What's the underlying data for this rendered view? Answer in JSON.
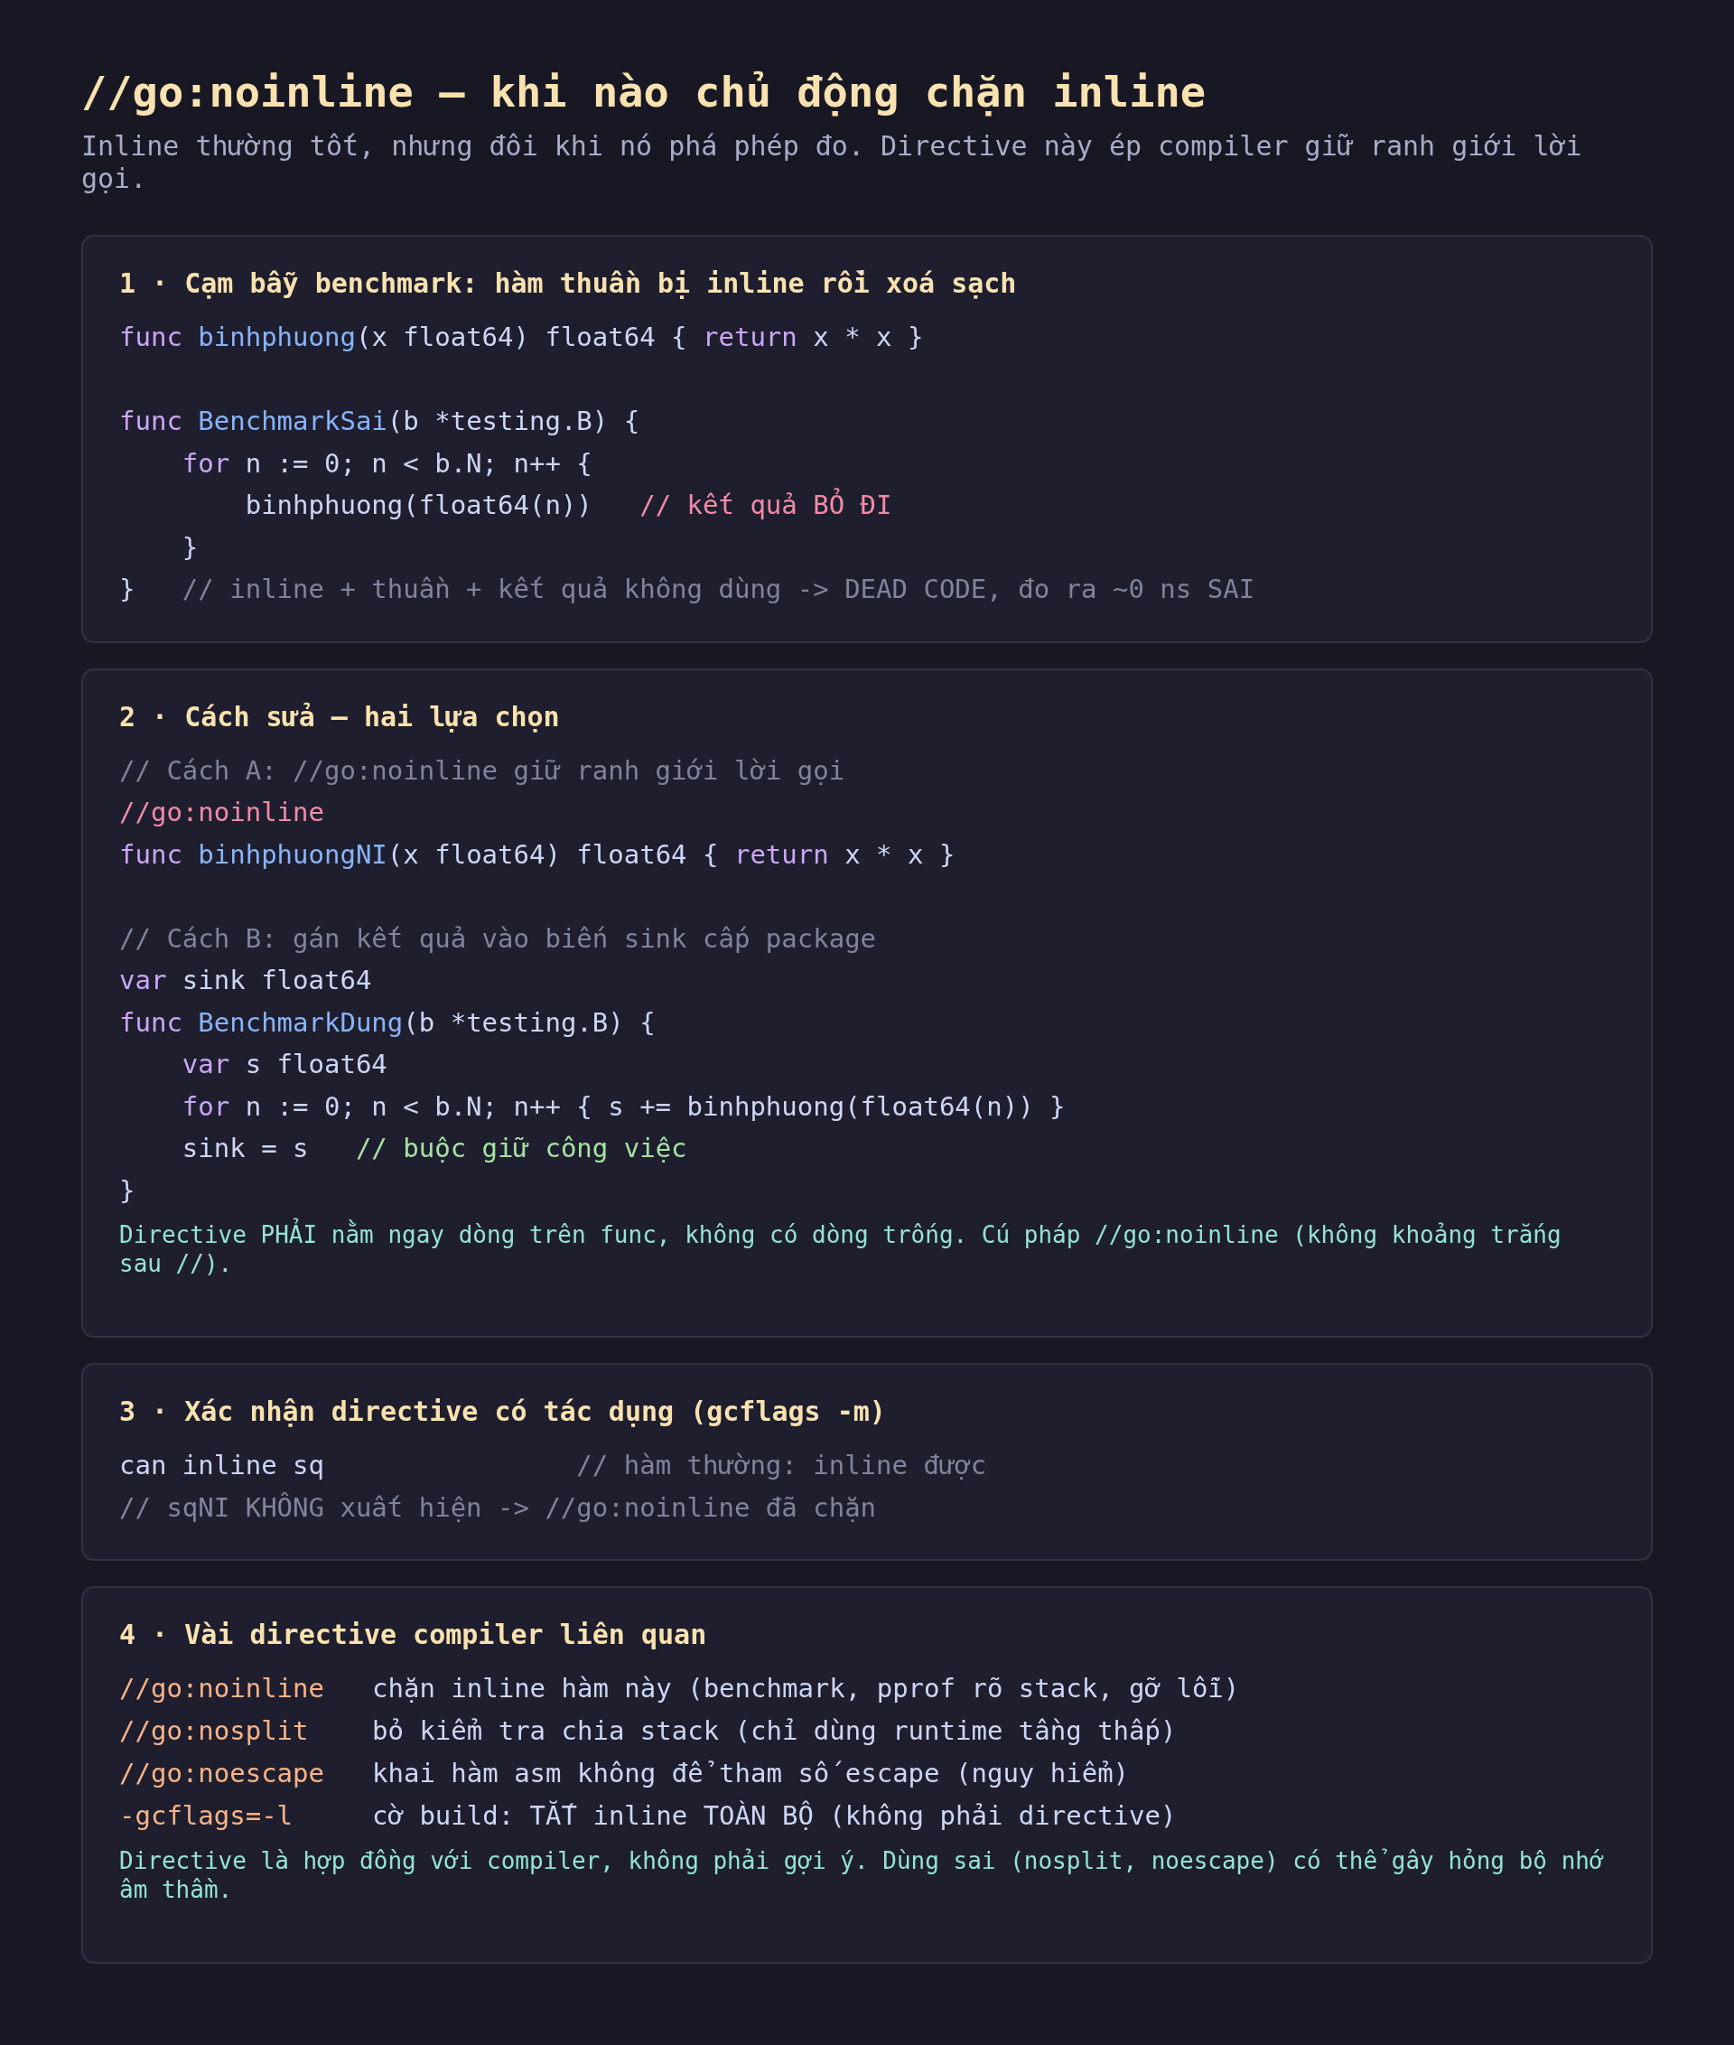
{
  "title": "//go:noinline — khi nào chủ động chặn inline",
  "subtitle": "Inline thường tốt, nhưng đôi khi nó phá phép đo. Directive này ép compiler giữ ranh giới lời gọi.",
  "cards": [
    {
      "kind": "code",
      "heading": "1 · Cạm bẫy benchmark: hàm thuần bị inline rồi xoá sạch",
      "lines": [
        {
          "kind": "code",
          "tokens": [
            {
              "kind": "kw",
              "text": "func "
            },
            {
              "kind": "fn",
              "text": "binhphuong"
            },
            {
              "kind": "plain",
              "text": "(x float64) float64 { "
            },
            {
              "kind": "kw",
              "text": "return"
            },
            {
              "kind": "plain",
              "text": " x * x }"
            }
          ]
        },
        {
          "kind": "blank"
        },
        {
          "kind": "code",
          "tokens": [
            {
              "kind": "kw",
              "text": "func "
            },
            {
              "kind": "fn",
              "text": "BenchmarkSai"
            },
            {
              "kind": "plain",
              "text": "(b *testing.B) {"
            }
          ]
        },
        {
          "kind": "code",
          "tokens": [
            {
              "kind": "kw",
              "text": "    for"
            },
            {
              "kind": "plain",
              "text": " n := 0; n < b.N; n++ {"
            }
          ]
        },
        {
          "kind": "code",
          "tokens": [
            {
              "kind": "plain",
              "text": "        binhphuong(float64(n))   "
            },
            {
              "kind": "warn",
              "text": "// kết quả BỎ ĐI"
            }
          ]
        },
        {
          "kind": "code",
          "tokens": [
            {
              "kind": "plain",
              "text": "    }"
            }
          ]
        },
        {
          "kind": "code",
          "tokens": [
            {
              "kind": "plain",
              "text": "}   "
            },
            {
              "kind": "comment",
              "text": "// inline + thuần + kết quả không dùng -> DEAD CODE, đo ra ~0 ns SAI"
            }
          ]
        }
      ]
    },
    {
      "kind": "code",
      "heading": "2 · Cách sửa — hai lựa chọn",
      "lines": [
        {
          "kind": "code",
          "tokens": [
            {
              "kind": "comment",
              "text": "// Cách A: //go:noinline giữ ranh giới lời gọi"
            }
          ]
        },
        {
          "kind": "code",
          "tokens": [
            {
              "kind": "warn",
              "text": "//go:noinline"
            }
          ]
        },
        {
          "kind": "code",
          "tokens": [
            {
              "kind": "kw",
              "text": "func "
            },
            {
              "kind": "fn",
              "text": "binhphuongNI"
            },
            {
              "kind": "plain",
              "text": "(x float64) float64 { "
            },
            {
              "kind": "kw",
              "text": "return"
            },
            {
              "kind": "plain",
              "text": " x * x }"
            }
          ]
        },
        {
          "kind": "blank"
        },
        {
          "kind": "code",
          "tokens": [
            {
              "kind": "comment",
              "text": "// Cách B: gán kết quả vào biến sink cấp package"
            }
          ]
        },
        {
          "kind": "code",
          "tokens": [
            {
              "kind": "kw",
              "text": "var"
            },
            {
              "kind": "plain",
              "text": " sink float64"
            }
          ]
        },
        {
          "kind": "code",
          "tokens": [
            {
              "kind": "kw",
              "text": "func "
            },
            {
              "kind": "fn",
              "text": "BenchmarkDung"
            },
            {
              "kind": "plain",
              "text": "(b *testing.B) {"
            }
          ]
        },
        {
          "kind": "code",
          "tokens": [
            {
              "kind": "kw",
              "text": "    var"
            },
            {
              "kind": "plain",
              "text": " s float64"
            }
          ]
        },
        {
          "kind": "code",
          "tokens": [
            {
              "kind": "kw",
              "text": "    for"
            },
            {
              "kind": "plain",
              "text": " n := 0; n < b.N; n++ { s += binhphuong(float64(n)) }"
            }
          ]
        },
        {
          "kind": "code",
          "tokens": [
            {
              "kind": "plain",
              "text": "    sink = s   "
            },
            {
              "kind": "good",
              "text": "// buộc giữ công việc"
            }
          ]
        },
        {
          "kind": "code",
          "tokens": [
            {
              "kind": "plain",
              "text": "}"
            }
          ]
        }
      ],
      "note": "Directive PHẢI nằm ngay dòng trên func, không có dòng trống. Cú pháp //go:noinline (không khoảng trắng sau //)."
    },
    {
      "kind": "code",
      "heading": "3 · Xác nhận directive có tác dụng (gcflags -m)",
      "lines": [
        {
          "kind": "code",
          "tokens": [
            {
              "kind": "plain",
              "text": "can inline sq                "
            },
            {
              "kind": "comment",
              "text": "// hàm thường: inline được"
            }
          ]
        },
        {
          "kind": "code",
          "tokens": [
            {
              "kind": "comment",
              "text": "// sqNI KHÔNG xuất hiện -> //go:noinline đã chặn"
            }
          ]
        }
      ]
    },
    {
      "kind": "table",
      "heading": "4 · Vài directive compiler liên quan",
      "rows": [
        {
          "name": "//go:noinline",
          "desc": "chặn inline hàm này (benchmark, pprof rõ stack, gỡ lỗi)"
        },
        {
          "name": "//go:nosplit",
          "desc": "bỏ kiểm tra chia stack (chỉ dùng runtime tầng thấp)"
        },
        {
          "name": "//go:noescape",
          "desc": "khai hàm asm không để tham số escape (nguy hiểm)"
        },
        {
          "name": "-gcflags=-l",
          "desc": "cờ build: TẮT inline TOÀN BỘ (không phải directive)"
        }
      ],
      "note": "Directive là hợp đồng với compiler, không phải gợi ý. Dùng sai (nosplit, noescape) có thể gây hỏng bộ nhớ âm thầm."
    }
  ]
}
